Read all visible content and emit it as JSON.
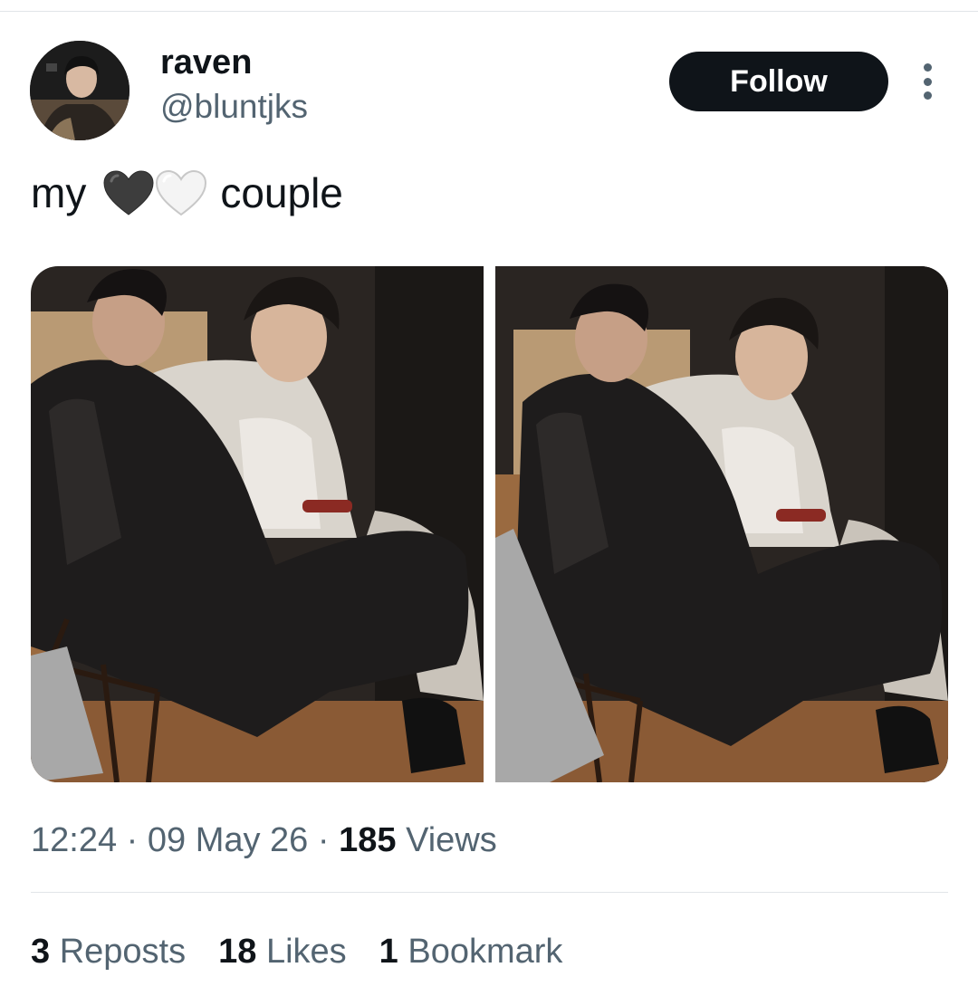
{
  "tweet": {
    "author": {
      "display_name": "raven",
      "handle": "@bluntjks",
      "avatar_icon": "profile-photo"
    },
    "follow_label": "Follow",
    "more_icon": "more-options-icon",
    "text": {
      "before": "my",
      "hearts": [
        "black-heart",
        "white-heart"
      ],
      "after": "couple"
    },
    "time": "12:24",
    "date": "09 May 26",
    "separator": "·",
    "views_count": "185",
    "views_label": "Views",
    "stats": {
      "reposts_count": "3",
      "reposts_label": "Reposts",
      "likes_count": "18",
      "likes_label": "Likes",
      "bookmarks_count": "1",
      "bookmarks_label": "Bookmark"
    }
  },
  "colors": {
    "text_primary": "#0f1419",
    "text_secondary": "#536471",
    "divider": "#e1e5e8",
    "follow_bg": "#0f1419",
    "follow_text": "#ffffff"
  }
}
